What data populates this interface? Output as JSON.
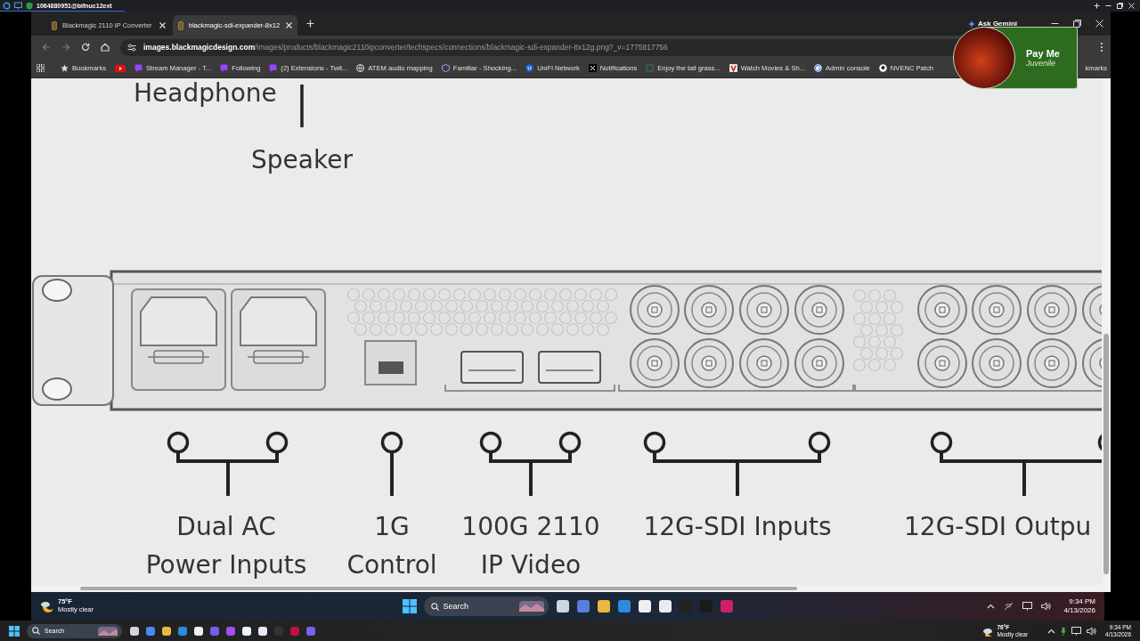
{
  "remote_session": {
    "title": "1064880951@bifnuc12ext"
  },
  "browser": {
    "tabs": [
      {
        "title": "Blackmagic 2110 IP Converter",
        "selected": false
      },
      {
        "title": "blackmagic-sdi-expander-8x12",
        "selected": true
      }
    ],
    "ask_gemini": "Ask Gemini",
    "address": {
      "host": "images.blackmagicdesign.com",
      "path": "/images/products/blackmagic2110ipconverter/techspecs/connections/blackmagic-sdi-expander-8x12g.png?_v=1775817756"
    },
    "bookmarks": [
      {
        "label": "Bookmarks"
      },
      {
        "label": "Stream Manager - T..."
      },
      {
        "label": "Following"
      },
      {
        "label": "(2) Extensions - Twit..."
      },
      {
        "label": "ATEM audio mapping"
      },
      {
        "label": "Familiar - Shocking..."
      },
      {
        "label": "UniFi Network"
      },
      {
        "label": "Notifications"
      },
      {
        "label": "Enjoy the tall grass..."
      },
      {
        "label": "Watch Movies & Sh..."
      },
      {
        "label": "Admin console"
      },
      {
        "label": "NVENC Patch"
      }
    ],
    "bookmarks_overflow": "kmarks"
  },
  "diagram": {
    "top_labels": [
      "Headphone",
      "Speaker"
    ],
    "callouts": [
      {
        "lines": [
          "Dual AC",
          "Power Inputs"
        ]
      },
      {
        "lines": [
          "1G",
          "Control"
        ]
      },
      {
        "lines": [
          "100G 2110",
          "IP Video"
        ]
      },
      {
        "lines": [
          "12G-SDI Inputs"
        ]
      },
      {
        "lines": [
          "12G-SDI Outpu"
        ]
      }
    ]
  },
  "overlay_card": {
    "title": "Pay Me",
    "subtitle": "Juvenile"
  },
  "taskbars": [
    {
      "kind": "remote",
      "weather": {
        "temp": "75°F",
        "condition": "Mostly clear"
      },
      "search": "Search",
      "time": "9:34 PM",
      "date": "4/13/2026"
    },
    {
      "kind": "local",
      "weather": {
        "temp": "76°F",
        "condition": "Mostly clear"
      },
      "search": "Search",
      "time": "9:34 PM",
      "date": "4/13/2026"
    }
  ]
}
